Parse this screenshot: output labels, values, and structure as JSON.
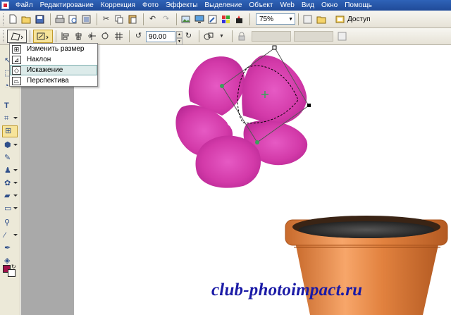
{
  "menubar": {
    "items": [
      "Файл",
      "Редактирование",
      "Коррекция",
      "Фото",
      "Эффекты",
      "Выделение",
      "Объект",
      "Web",
      "Вид",
      "Окно",
      "Помощь"
    ]
  },
  "toolbar1": {
    "zoom_value": "75%",
    "access_label": "Доступ"
  },
  "toolbar2": {
    "rotation_angle": "90.00"
  },
  "transform_menu": {
    "items": [
      "Изменить размер",
      "Наклон",
      "Искажение",
      "Перспектива"
    ],
    "highlighted_index": 2
  },
  "canvas": {
    "watermark": "club-photoimpact.ru"
  },
  "colors": {
    "foreground": "#a0104a",
    "background": "#ffffff",
    "flower": "#d33aa9",
    "pot": "#e0803a",
    "menubar": "#2454a8"
  },
  "icons": [
    "new-icon",
    "open-icon",
    "save-icon",
    "print-icon",
    "undo-icon",
    "redo-icon",
    "rotate-left-icon",
    "rotate-right-icon",
    "transform-icon",
    "crop-icon",
    "text-icon",
    "brush-icon",
    "eraser-icon",
    "zoom-icon",
    "eyedropper-icon",
    "color-swatch-icon"
  ]
}
